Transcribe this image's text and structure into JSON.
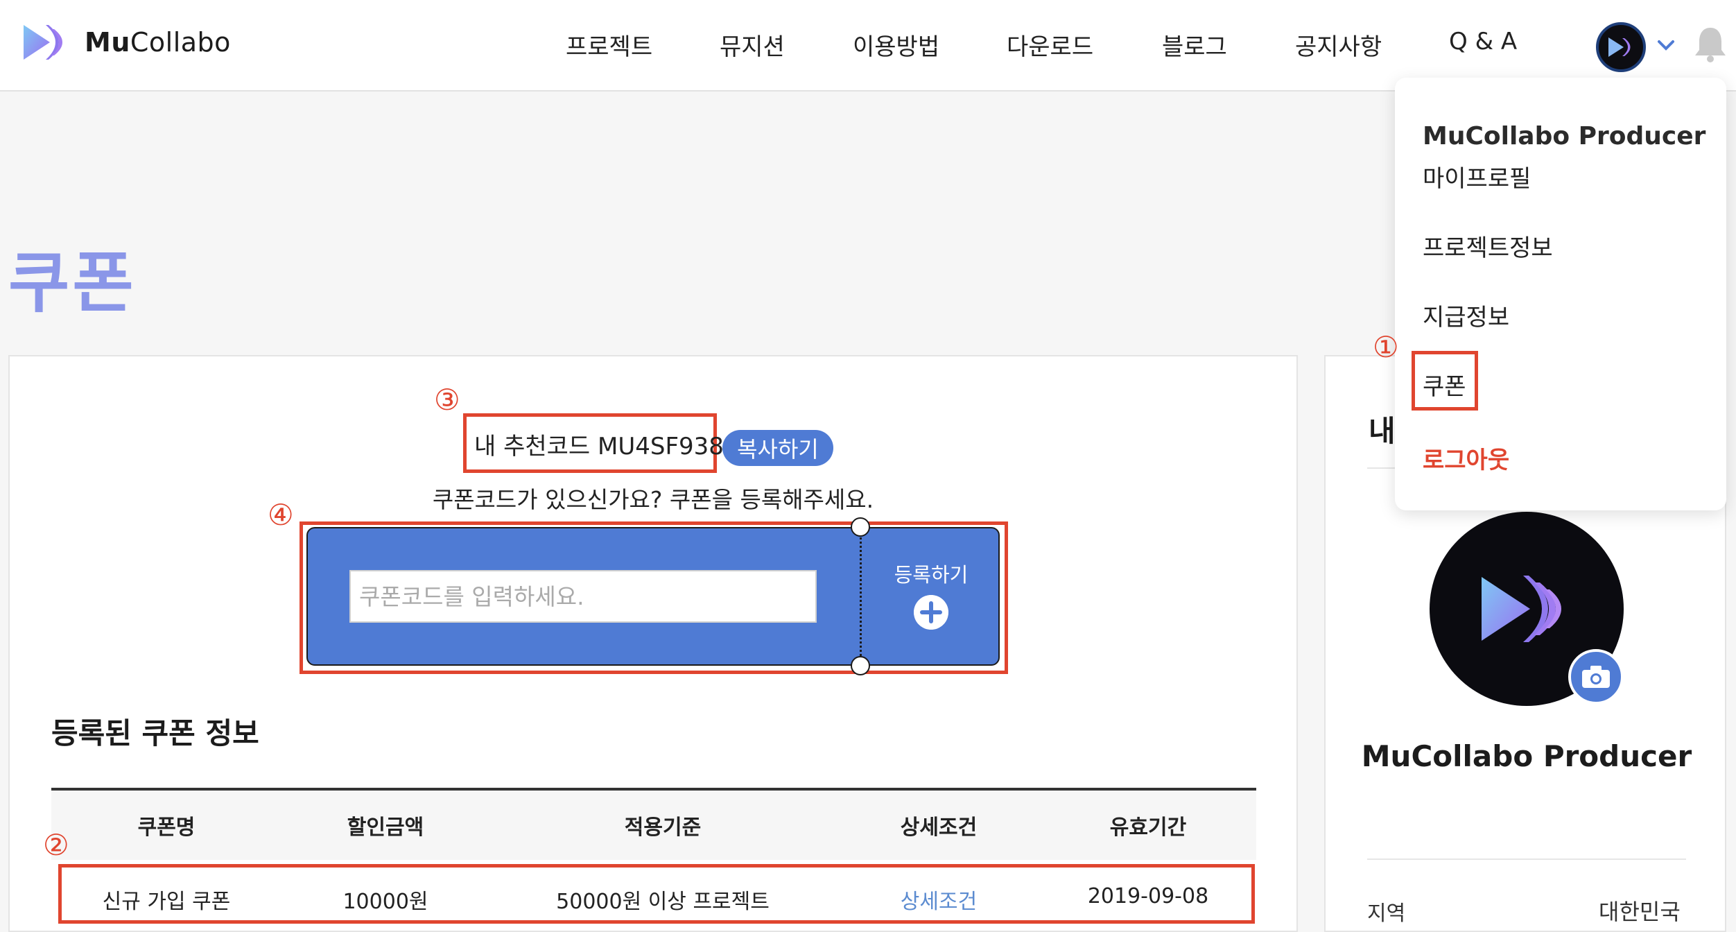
{
  "header": {
    "logo_bold": "Mu",
    "logo_rest": "Collabo",
    "nav": [
      "프로젝트",
      "뮤지션",
      "이용방법",
      "다운로드",
      "블로그",
      "공지사항",
      "Q & A"
    ]
  },
  "page": {
    "title": "쿠폰"
  },
  "coupon": {
    "referral_text": "내 추천코드 MU4SF938",
    "copy_label": "복사하기",
    "question": "쿠폰코드가 있으신가요? 쿠폰을 등록해주세요.",
    "input_placeholder": "쿠폰코드를 입력하세요.",
    "register_label": "등록하기"
  },
  "registered": {
    "title": "등록된 쿠폰 정보",
    "columns": [
      "쿠폰명",
      "할인금액",
      "적용기준",
      "상세조건",
      "유효기간"
    ],
    "rows": [
      [
        "신규 가입 쿠폰",
        "10000원",
        "50000원 이상 프로젝트",
        "상세조건",
        "2019-09-08"
      ]
    ]
  },
  "side": {
    "title": "내",
    "name": "MuCollabo Producer",
    "region_label": "지역",
    "region_value": "대한민국"
  },
  "dropdown": {
    "title": "MuCollabo Producer",
    "items": [
      "마이프로필",
      "프로젝트정보",
      "지급정보",
      "쿠폰"
    ],
    "logout": "로그아웃"
  },
  "markers": [
    "①",
    "②",
    "③",
    "④"
  ],
  "colors": {
    "accent": "#4f7bd4",
    "highlight": "#e0452f",
    "title": "#8a96e8",
    "link": "#5b8bd0"
  }
}
